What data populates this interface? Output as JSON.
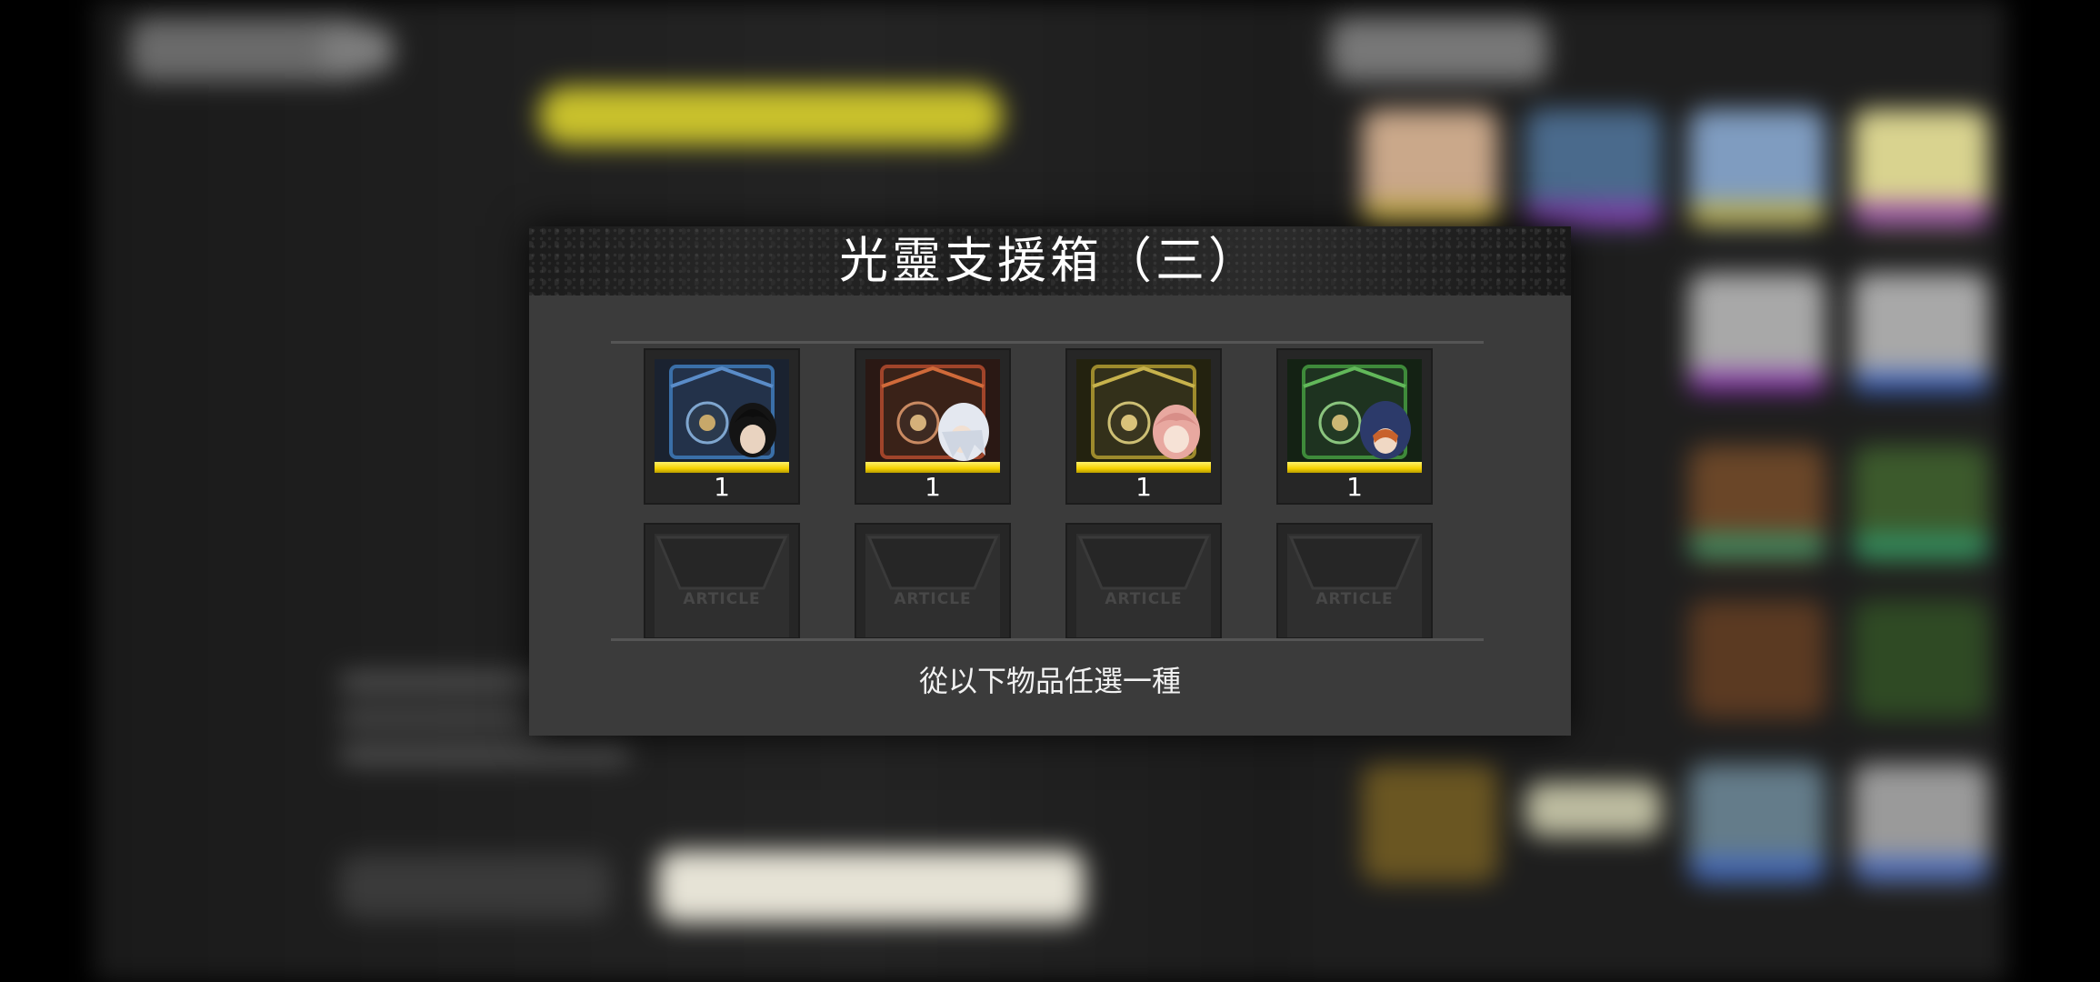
{
  "dialog": {
    "title": "光靈支援箱（三）",
    "instruction": "從以下物品任選一種"
  },
  "items": [
    {
      "name": "support-box-blue",
      "quantity": "1",
      "frame_color": "#3a6fa8",
      "character_icon": "dark-haired-hero-icon"
    },
    {
      "name": "support-box-red",
      "quantity": "1",
      "frame_color": "#a0442a",
      "character_icon": "white-haired-hero-icon"
    },
    {
      "name": "support-box-yellow",
      "quantity": "1",
      "frame_color": "#9d8a2c",
      "character_icon": "pink-haired-hero-icon"
    },
    {
      "name": "support-box-green",
      "quantity": "1",
      "frame_color": "#3e8a3a",
      "character_icon": "hooded-hero-icon"
    }
  ],
  "empty_slots": [
    {
      "label": "ARTICLE"
    },
    {
      "label": "ARTICLE"
    },
    {
      "label": "ARTICLE"
    },
    {
      "label": "ARTICLE"
    }
  ],
  "colors": {
    "rarity_bar": "#f6d200",
    "dialog_bg": "#3b3b3b",
    "header_bg": "#1f1f1f"
  }
}
